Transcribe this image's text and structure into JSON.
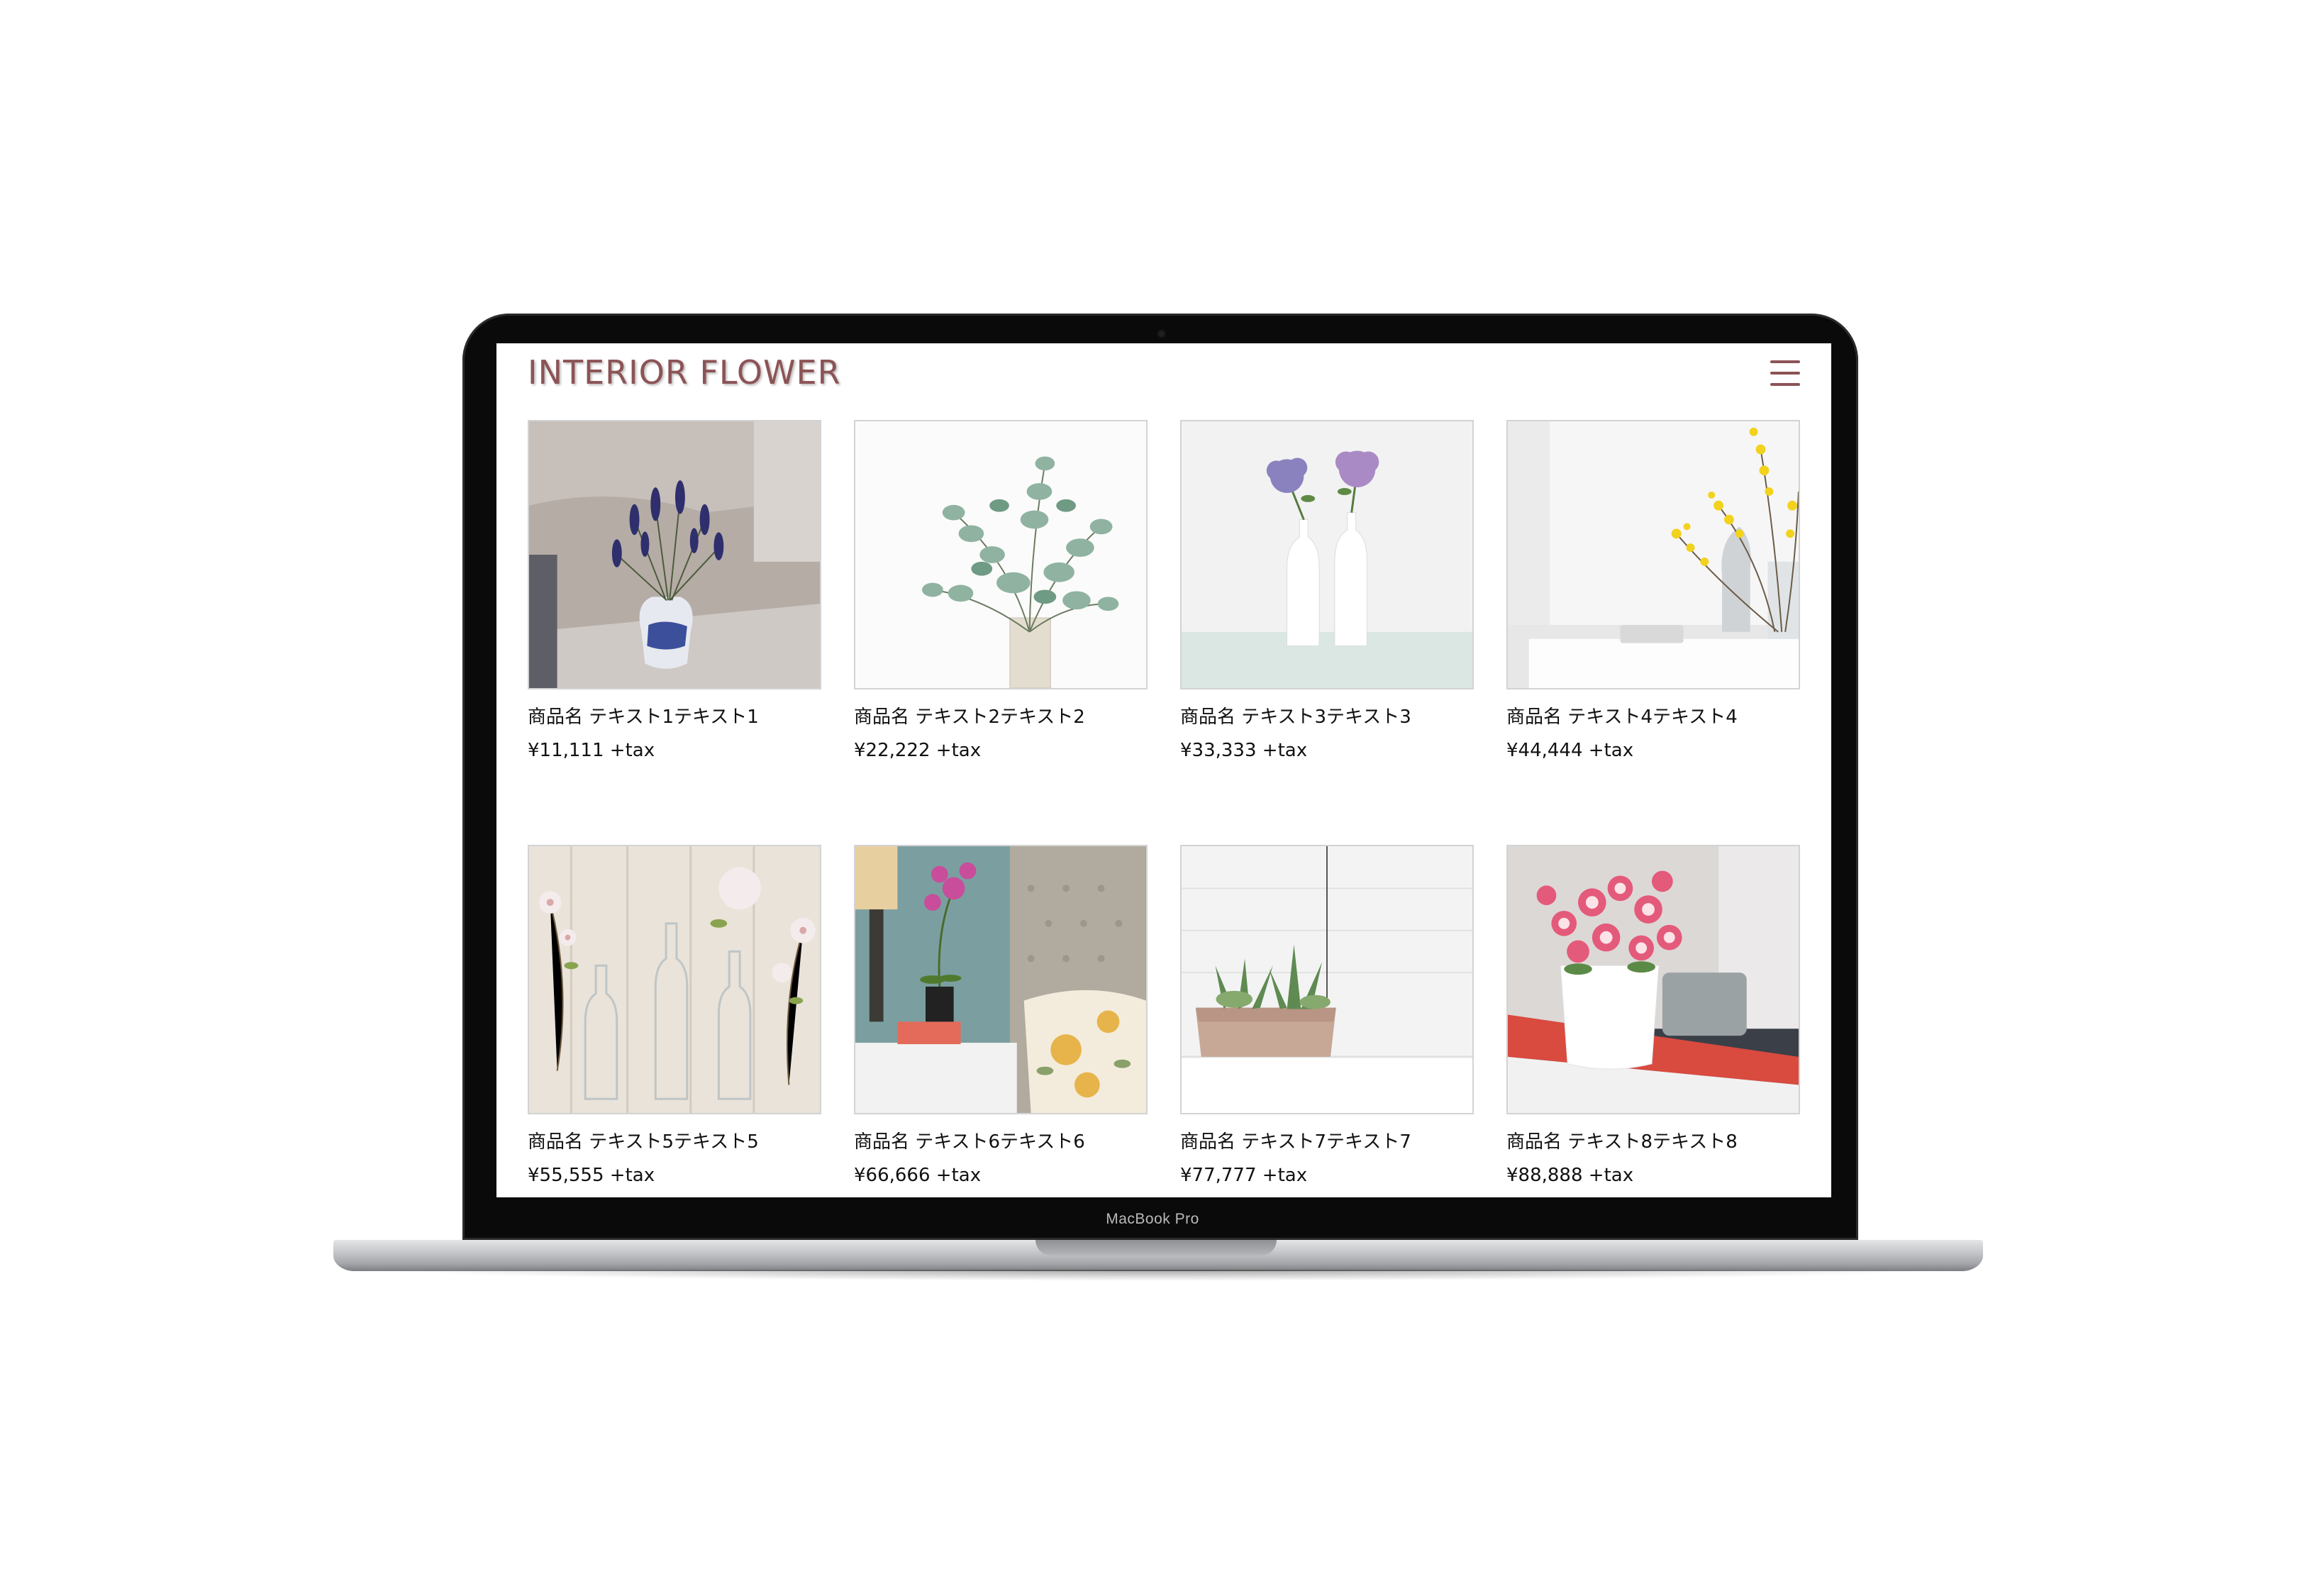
{
  "device": {
    "model_label": "MacBook Pro"
  },
  "header": {
    "logo": "INTERIOR FLOWER",
    "menu_icon": "hamburger-menu-icon"
  },
  "colors": {
    "brand": "#8c5356",
    "text": "#111111",
    "image_border": "#d3d3d3"
  },
  "products": [
    {
      "name": "商品名 テキスト1テキスト1",
      "price": "¥11,111 +tax",
      "image": "lavender-in-blue-vase"
    },
    {
      "name": "商品名 テキスト2テキスト2",
      "price": "¥22,222 +tax",
      "image": "eucalyptus-in-glass-vase"
    },
    {
      "name": "商品名 テキスト3テキスト3",
      "price": "¥33,333 +tax",
      "image": "hydrangea-in-white-bottles"
    },
    {
      "name": "商品名 テキスト4テキスト4",
      "price": "¥44,444 +tax",
      "image": "yellow-forsythia-branches"
    },
    {
      "name": "商品名 テキスト5テキスト5",
      "price": "¥55,555 +tax",
      "image": "blossoms-in-glass-bottles"
    },
    {
      "name": "商品名 テキスト6テキスト6",
      "price": "¥66,666 +tax",
      "image": "orchid-on-nightstand"
    },
    {
      "name": "商品名 テキスト7テキスト7",
      "price": "¥77,777 +tax",
      "image": "succulents-in-planter"
    },
    {
      "name": "商品名 テキスト8テキスト8",
      "price": "¥88,888 +tax",
      "image": "pink-flowers-on-books"
    }
  ]
}
